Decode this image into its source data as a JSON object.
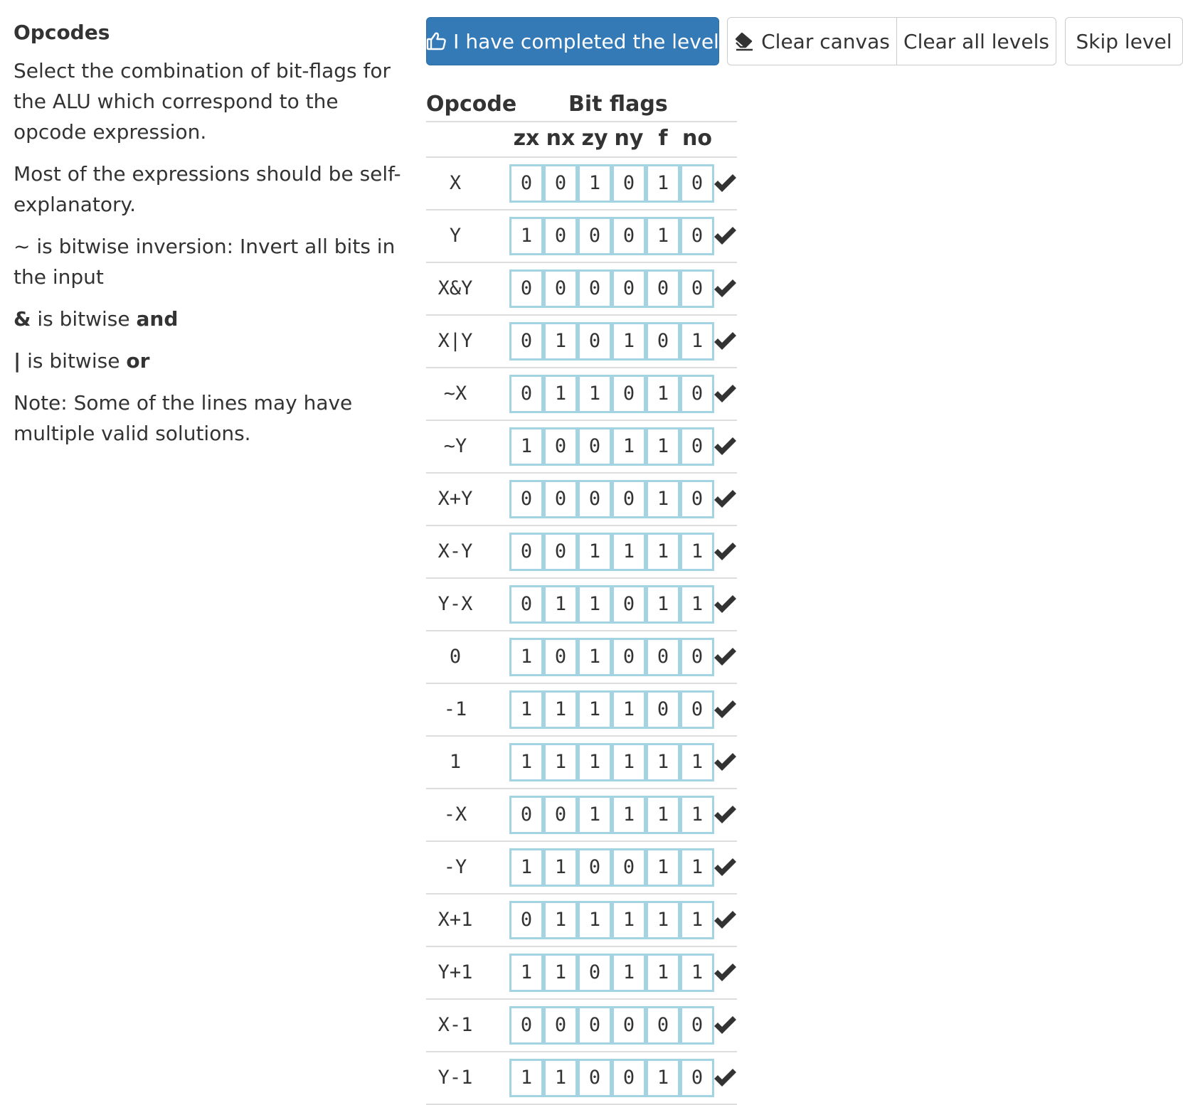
{
  "sidebar": {
    "title": "Opcodes",
    "intro": "Select the combination of bit-flags for the ALU which correspond to the opcode expression.",
    "self_explanatory": "Most of the expressions should be self-explanatory.",
    "inv_symbol": "~",
    "inv_text": " is bitwise inversion: Invert all bits in the input",
    "and_symbol": "&",
    "and_prefix": " is bitwise ",
    "and_word": "and",
    "or_symbol": "|",
    "or_prefix": " is bitwise ",
    "or_word": "or",
    "note": "Note: Some of the lines may have multiple valid solutions."
  },
  "toolbar": {
    "complete_label": "I have completed the level",
    "clear_canvas_label": "Clear canvas",
    "clear_levels_label": "Clear all levels",
    "skip_label": "Skip level"
  },
  "table": {
    "opcode_header": "Opcode",
    "flags_header": "Bit flags",
    "flag_names": [
      "zx",
      "nx",
      "zy",
      "ny",
      "f",
      "no"
    ],
    "rows": [
      {
        "op": "X",
        "bits": [
          "0",
          "0",
          "1",
          "0",
          "1",
          "0"
        ],
        "status": "check-icon"
      },
      {
        "op": "Y",
        "bits": [
          "1",
          "0",
          "0",
          "0",
          "1",
          "0"
        ],
        "status": "check-icon"
      },
      {
        "op": "X&Y",
        "bits": [
          "0",
          "0",
          "0",
          "0",
          "0",
          "0"
        ],
        "status": "check-icon"
      },
      {
        "op": "X|Y",
        "bits": [
          "0",
          "1",
          "0",
          "1",
          "0",
          "1"
        ],
        "status": "check-icon"
      },
      {
        "op": "~X",
        "bits": [
          "0",
          "1",
          "1",
          "0",
          "1",
          "0"
        ],
        "status": "check-icon"
      },
      {
        "op": "~Y",
        "bits": [
          "1",
          "0",
          "0",
          "1",
          "1",
          "0"
        ],
        "status": "check-icon"
      },
      {
        "op": "X+Y",
        "bits": [
          "0",
          "0",
          "0",
          "0",
          "1",
          "0"
        ],
        "status": "check-icon"
      },
      {
        "op": "X-Y",
        "bits": [
          "0",
          "0",
          "1",
          "1",
          "1",
          "1"
        ],
        "status": "check-icon"
      },
      {
        "op": "Y-X",
        "bits": [
          "0",
          "1",
          "1",
          "0",
          "1",
          "1"
        ],
        "status": "check-icon"
      },
      {
        "op": "0",
        "bits": [
          "1",
          "0",
          "1",
          "0",
          "0",
          "0"
        ],
        "status": "check-icon"
      },
      {
        "op": "-1",
        "bits": [
          "1",
          "1",
          "1",
          "1",
          "0",
          "0"
        ],
        "status": "check-icon"
      },
      {
        "op": "1",
        "bits": [
          "1",
          "1",
          "1",
          "1",
          "1",
          "1"
        ],
        "status": "check-icon"
      },
      {
        "op": "-X",
        "bits": [
          "0",
          "0",
          "1",
          "1",
          "1",
          "1"
        ],
        "status": "check-icon"
      },
      {
        "op": "-Y",
        "bits": [
          "1",
          "1",
          "0",
          "0",
          "1",
          "1"
        ],
        "status": "check-icon"
      },
      {
        "op": "X+1",
        "bits": [
          "0",
          "1",
          "1",
          "1",
          "1",
          "1"
        ],
        "status": "check-icon"
      },
      {
        "op": "Y+1",
        "bits": [
          "1",
          "1",
          "0",
          "1",
          "1",
          "1"
        ],
        "status": "check-icon"
      },
      {
        "op": "X-1",
        "bits": [
          "0",
          "0",
          "0",
          "0",
          "0",
          "0"
        ],
        "status": "check-icon"
      },
      {
        "op": "Y-1",
        "bits": [
          "1",
          "1",
          "0",
          "0",
          "1",
          "0"
        ],
        "status": "check-icon"
      }
    ]
  },
  "colors": {
    "primary": "#337ab7",
    "cell_border": "#a4d4e3",
    "text": "#333333",
    "divider": "#dddddd"
  }
}
